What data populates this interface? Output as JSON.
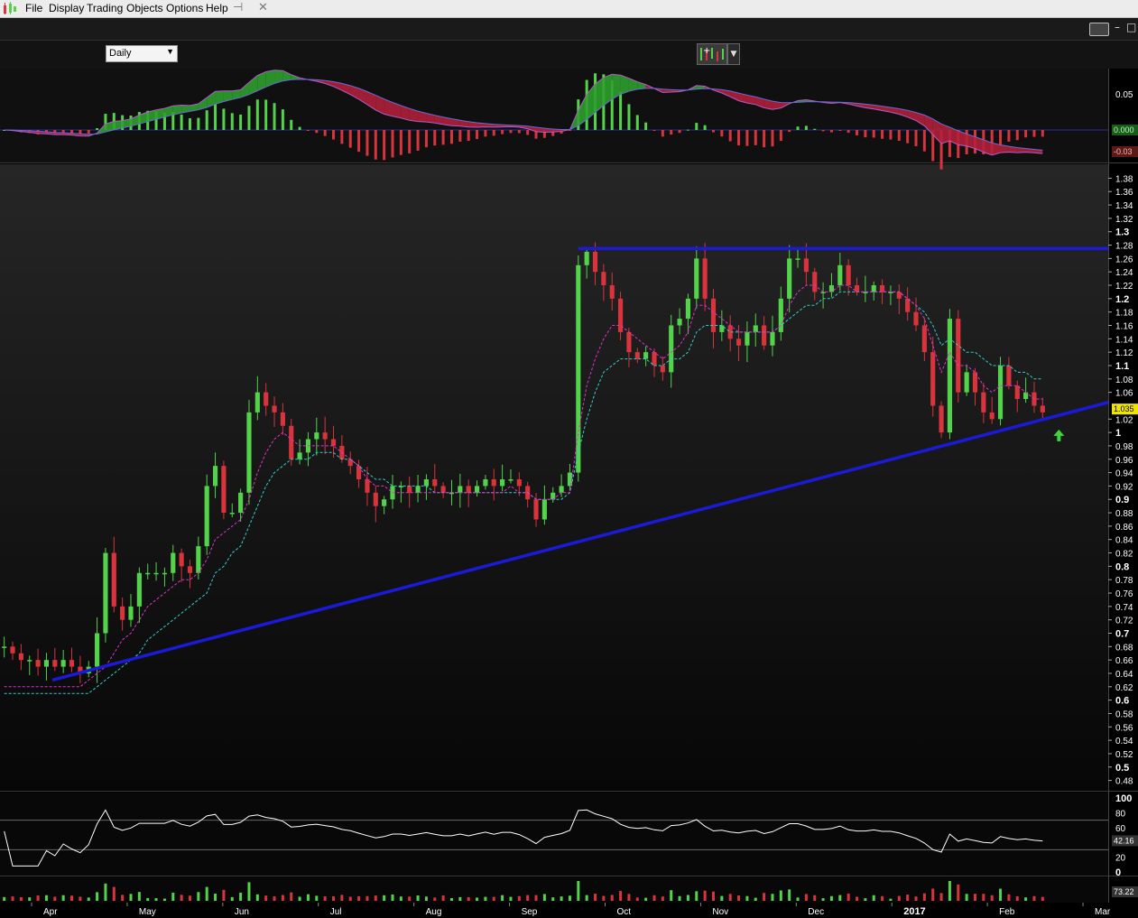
{
  "menu": {
    "items": [
      "File",
      "Display",
      "Trading",
      "Objects",
      "Options",
      "Help"
    ]
  },
  "toolbar": {
    "min_glyph": "–",
    "max_glyph": "□"
  },
  "period": {
    "value": "Daily"
  },
  "colors": {
    "up": "#52d34a",
    "down": "#d9343c",
    "trendline": "#1a1ad8",
    "ma_fast": "#e030d0",
    "ma_slow": "#33cccc",
    "price_badge": "#f0e400",
    "macd_fill_pos": "#2e9e2e",
    "macd_fill_neg": "#b0203a"
  },
  "chart_data": [
    {
      "type": "bar",
      "panel": "macd",
      "yticks": [
        "0.05",
        "0.000",
        "-0.03"
      ],
      "last_values": [
        "0.000",
        "-0.03"
      ],
      "ylim": [
        -0.04,
        0.075
      ]
    },
    {
      "type": "line",
      "panel": "price-candlestick",
      "yticks": [
        "1.38",
        "1.36",
        "1.34",
        "1.32",
        "1.3",
        "1.28",
        "1.26",
        "1.24",
        "1.22",
        "1.2",
        "1.18",
        "1.16",
        "1.14",
        "1.12",
        "1.1",
        "1.08",
        "1.06",
        "1.02",
        "1",
        "0.98",
        "0.96",
        "0.94",
        "0.92",
        "0.9",
        "0.88",
        "0.86",
        "0.84",
        "0.82",
        "0.8",
        "0.78",
        "0.76",
        "0.74",
        "0.72",
        "0.7",
        "0.68",
        "0.66",
        "0.64",
        "0.62",
        "0.6",
        "0.58",
        "0.56",
        "0.54",
        "0.52",
        "0.5",
        "0.48"
      ],
      "major_ticks": [
        "1.3",
        "1.2",
        "1.1",
        "1",
        "0.9",
        "0.8",
        "0.7",
        "0.6",
        "0.5"
      ],
      "ylim": [
        0.47,
        1.39
      ],
      "last_price": "1.035",
      "months": [
        "Apr",
        "May",
        "Jun",
        "Jul",
        "Aug",
        "Sep",
        "Oct",
        "Nov",
        "Dec",
        "2017",
        "Feb",
        "Mar"
      ],
      "series": [
        {
          "values": [
            0.68,
            0.67,
            0.66,
            0.66,
            0.65,
            0.66,
            0.65,
            0.66,
            0.65,
            0.64,
            0.65,
            0.7,
            0.82,
            0.74,
            0.72,
            0.74,
            0.79,
            0.79,
            0.79,
            0.79,
            0.82,
            0.8,
            0.79,
            0.83,
            0.92,
            0.95,
            0.88,
            0.88,
            0.91,
            1.03,
            1.06,
            1.04,
            1.03,
            1.01,
            0.96,
            0.97,
            0.99,
            1.0,
            0.99,
            0.98,
            0.96,
            0.95,
            0.93,
            0.91,
            0.89,
            0.9,
            0.92,
            0.92,
            0.91,
            0.92,
            0.93,
            0.92,
            0.91,
            0.91,
            0.92,
            0.91,
            0.92,
            0.93,
            0.92,
            0.93,
            0.93,
            0.92,
            0.9,
            0.87,
            0.9,
            0.91,
            0.92,
            0.94,
            1.25,
            1.27,
            1.24,
            1.22,
            1.2,
            1.15,
            1.12,
            1.11,
            1.12,
            1.1,
            1.09,
            1.16,
            1.17,
            1.2,
            1.26,
            1.2,
            1.15,
            1.16,
            1.14,
            1.13,
            1.15,
            1.16,
            1.13,
            1.15,
            1.2,
            1.26,
            1.26,
            1.24,
            1.21,
            1.21,
            1.22,
            1.25,
            1.22,
            1.21,
            1.21,
            1.22,
            1.21,
            1.21,
            1.2,
            1.18,
            1.16,
            1.12,
            1.04,
            1.0,
            1.17,
            1.06,
            1.09,
            1.06,
            1.03,
            1.02,
            1.1,
            1.07,
            1.05,
            1.06,
            1.04,
            1.03
          ]
        },
        {
          "values": [
            0.62,
            0.62,
            0.62,
            0.62,
            0.62,
            0.62,
            0.62,
            0.62,
            0.62,
            0.62,
            0.63,
            0.64,
            0.65,
            0.67,
            0.69,
            0.7,
            0.72,
            0.74,
            0.75,
            0.76,
            0.77,
            0.78,
            0.78,
            0.79,
            0.81,
            0.84,
            0.85,
            0.86,
            0.87,
            0.9,
            0.94,
            0.97,
            0.99,
            1.0,
            0.99,
            0.98,
            0.98,
            0.98,
            0.98,
            0.98,
            0.97,
            0.96,
            0.95,
            0.93,
            0.92,
            0.92,
            0.91,
            0.91,
            0.91,
            0.91,
            0.91,
            0.91,
            0.91,
            0.91,
            0.91,
            0.91,
            0.91,
            0.91,
            0.91,
            0.91,
            0.92,
            0.91,
            0.91,
            0.9,
            0.9,
            0.9,
            0.91,
            0.91,
            1.0,
            1.07,
            1.11,
            1.14,
            1.16,
            1.16,
            1.15,
            1.14,
            1.13,
            1.12,
            1.11,
            1.12,
            1.13,
            1.15,
            1.19,
            1.19,
            1.18,
            1.17,
            1.16,
            1.15,
            1.15,
            1.15,
            1.15,
            1.15,
            1.16,
            1.19,
            1.21,
            1.22,
            1.22,
            1.21,
            1.21,
            1.22,
            1.22,
            1.21,
            1.21,
            1.21,
            1.21,
            1.21,
            1.21,
            1.2,
            1.19,
            1.17,
            1.13,
            1.09,
            1.12,
            1.1,
            1.1,
            1.09,
            1.07,
            1.06,
            1.07,
            1.07,
            1.07,
            1.06,
            1.05,
            1.05
          ]
        },
        {
          "values": [
            0.61,
            0.61,
            0.61,
            0.61,
            0.61,
            0.61,
            0.61,
            0.61,
            0.61,
            0.61,
            0.61,
            0.62,
            0.63,
            0.64,
            0.65,
            0.66,
            0.67,
            0.69,
            0.7,
            0.71,
            0.72,
            0.73,
            0.74,
            0.75,
            0.76,
            0.79,
            0.8,
            0.82,
            0.83,
            0.86,
            0.89,
            0.92,
            0.94,
            0.95,
            0.96,
            0.96,
            0.96,
            0.97,
            0.97,
            0.97,
            0.96,
            0.96,
            0.95,
            0.94,
            0.93,
            0.93,
            0.92,
            0.92,
            0.92,
            0.92,
            0.92,
            0.91,
            0.91,
            0.91,
            0.91,
            0.91,
            0.91,
            0.91,
            0.91,
            0.91,
            0.91,
            0.91,
            0.91,
            0.9,
            0.9,
            0.9,
            0.9,
            0.91,
            0.97,
            1.02,
            1.06,
            1.09,
            1.1,
            1.11,
            1.11,
            1.11,
            1.11,
            1.1,
            1.1,
            1.11,
            1.11,
            1.12,
            1.15,
            1.16,
            1.16,
            1.16,
            1.15,
            1.15,
            1.15,
            1.15,
            1.15,
            1.15,
            1.16,
            1.17,
            1.18,
            1.19,
            1.19,
            1.2,
            1.2,
            1.21,
            1.21,
            1.21,
            1.21,
            1.21,
            1.21,
            1.21,
            1.21,
            1.2,
            1.19,
            1.18,
            1.16,
            1.13,
            1.14,
            1.13,
            1.12,
            1.12,
            1.11,
            1.1,
            1.1,
            1.1,
            1.09,
            1.09,
            1.08,
            1.08
          ]
        }
      ],
      "support_line": {
        "start": [
          "Apr",
          0.63
        ],
        "end": [
          "Mar",
          1.045
        ]
      },
      "resistance_line": {
        "value": 1.275
      }
    },
    {
      "type": "line",
      "panel": "oscillator",
      "yticks": [
        "100",
        "80",
        "60",
        "42.16",
        "20",
        "0"
      ],
      "last_value": "42.16",
      "ylim": [
        0,
        100
      ],
      "levels": [
        70,
        30
      ]
    },
    {
      "type": "bar",
      "panel": "volume",
      "last_value": "73.22"
    }
  ]
}
